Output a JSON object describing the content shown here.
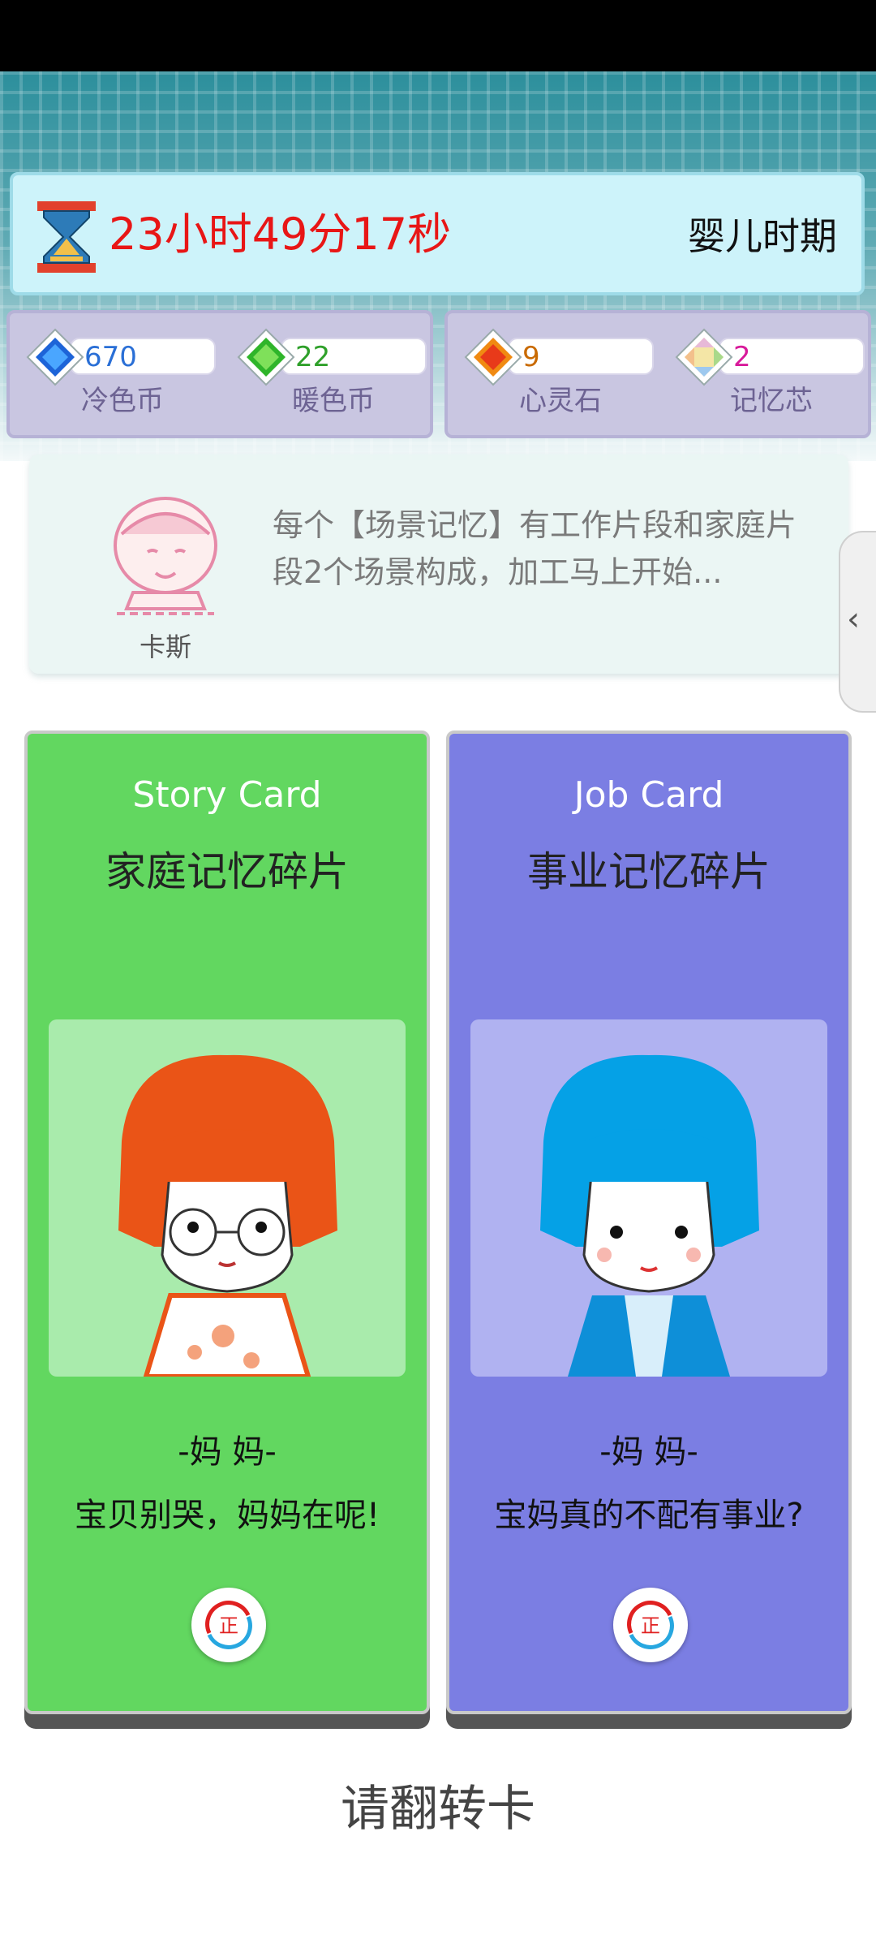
{
  "timer": {
    "text": "23小时49分17秒",
    "period": "婴儿时期",
    "icon": "hourglass-icon"
  },
  "resources": [
    {
      "value": "670",
      "name": "冷色币",
      "color": "#2a6fd6",
      "icon": "blue-gem-icon"
    },
    {
      "value": "22",
      "name": "暖色币",
      "color": "#2fa02a",
      "icon": "green-gem-icon"
    },
    {
      "value": "9",
      "name": "心灵石",
      "color": "#c96a00",
      "icon": "orange-gem-icon"
    },
    {
      "value": "2",
      "name": "记忆芯",
      "color": "#d81a9a",
      "icon": "rainbow-gem-icon"
    }
  ],
  "npc": {
    "name": "卡斯",
    "message": "每个【场景记忆】有工作片段和家庭片段2个场景构成，加工马上开始..."
  },
  "side_tab": {
    "label": "‹"
  },
  "cards": [
    {
      "title_en": "Story Card",
      "title_zh": "家庭记忆碎片",
      "role": "-妈 妈-",
      "quote": "宝贝别哭，妈妈在呢!",
      "flip_label": "正",
      "color": "#62d760"
    },
    {
      "title_en": "Job Card",
      "title_zh": "事业记忆碎片",
      "role": "-妈 妈-",
      "quote": "宝妈真的不配有事业?",
      "flip_label": "正",
      "color": "#7b7ee3"
    }
  ],
  "footer": {
    "hint": "请翻转卡"
  }
}
